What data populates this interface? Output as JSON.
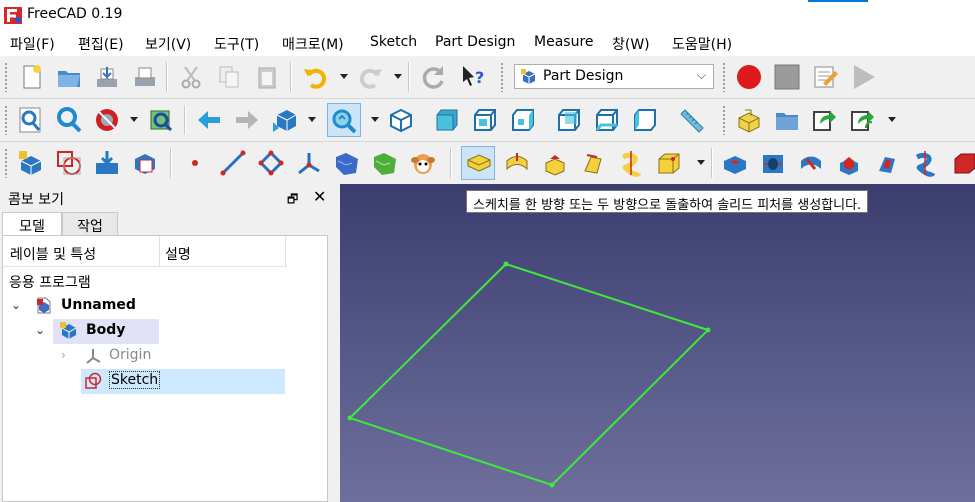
{
  "window": {
    "title": "FreeCAD 0.19"
  },
  "menu": [
    "파일(F)",
    "편집(E)",
    "보기(V)",
    "도구(T)",
    "매크로(M)",
    "Sketch",
    "Part Design",
    "Measure",
    "창(W)",
    "도움말(H)"
  ],
  "workbench": {
    "selected": "Part Design"
  },
  "tooltip": "스케치를 한 방향 또는 두 방향으로 돌출하여 솔리드 피처를 생성합니다.",
  "combo_view": {
    "title": "콤보 보기",
    "tabs": [
      "모델",
      "작업"
    ],
    "columns": {
      "label": "레이블 및 특성",
      "description": "설명"
    },
    "section": "응용 프로그램",
    "tree": [
      {
        "label": "Unnamed",
        "icon": "document-icon"
      },
      {
        "label": "Body",
        "icon": "body-icon"
      },
      {
        "label": "Origin",
        "icon": "origin-icon"
      },
      {
        "label": "Sketch",
        "icon": "sketch-icon"
      }
    ]
  },
  "colors": {
    "sketch_line": "#3ee83e",
    "body_highlight": "#e1e1f8",
    "selection": "#cde8ff",
    "view_top": "#3a3d6e",
    "view_bottom": "#6e6f9a"
  }
}
